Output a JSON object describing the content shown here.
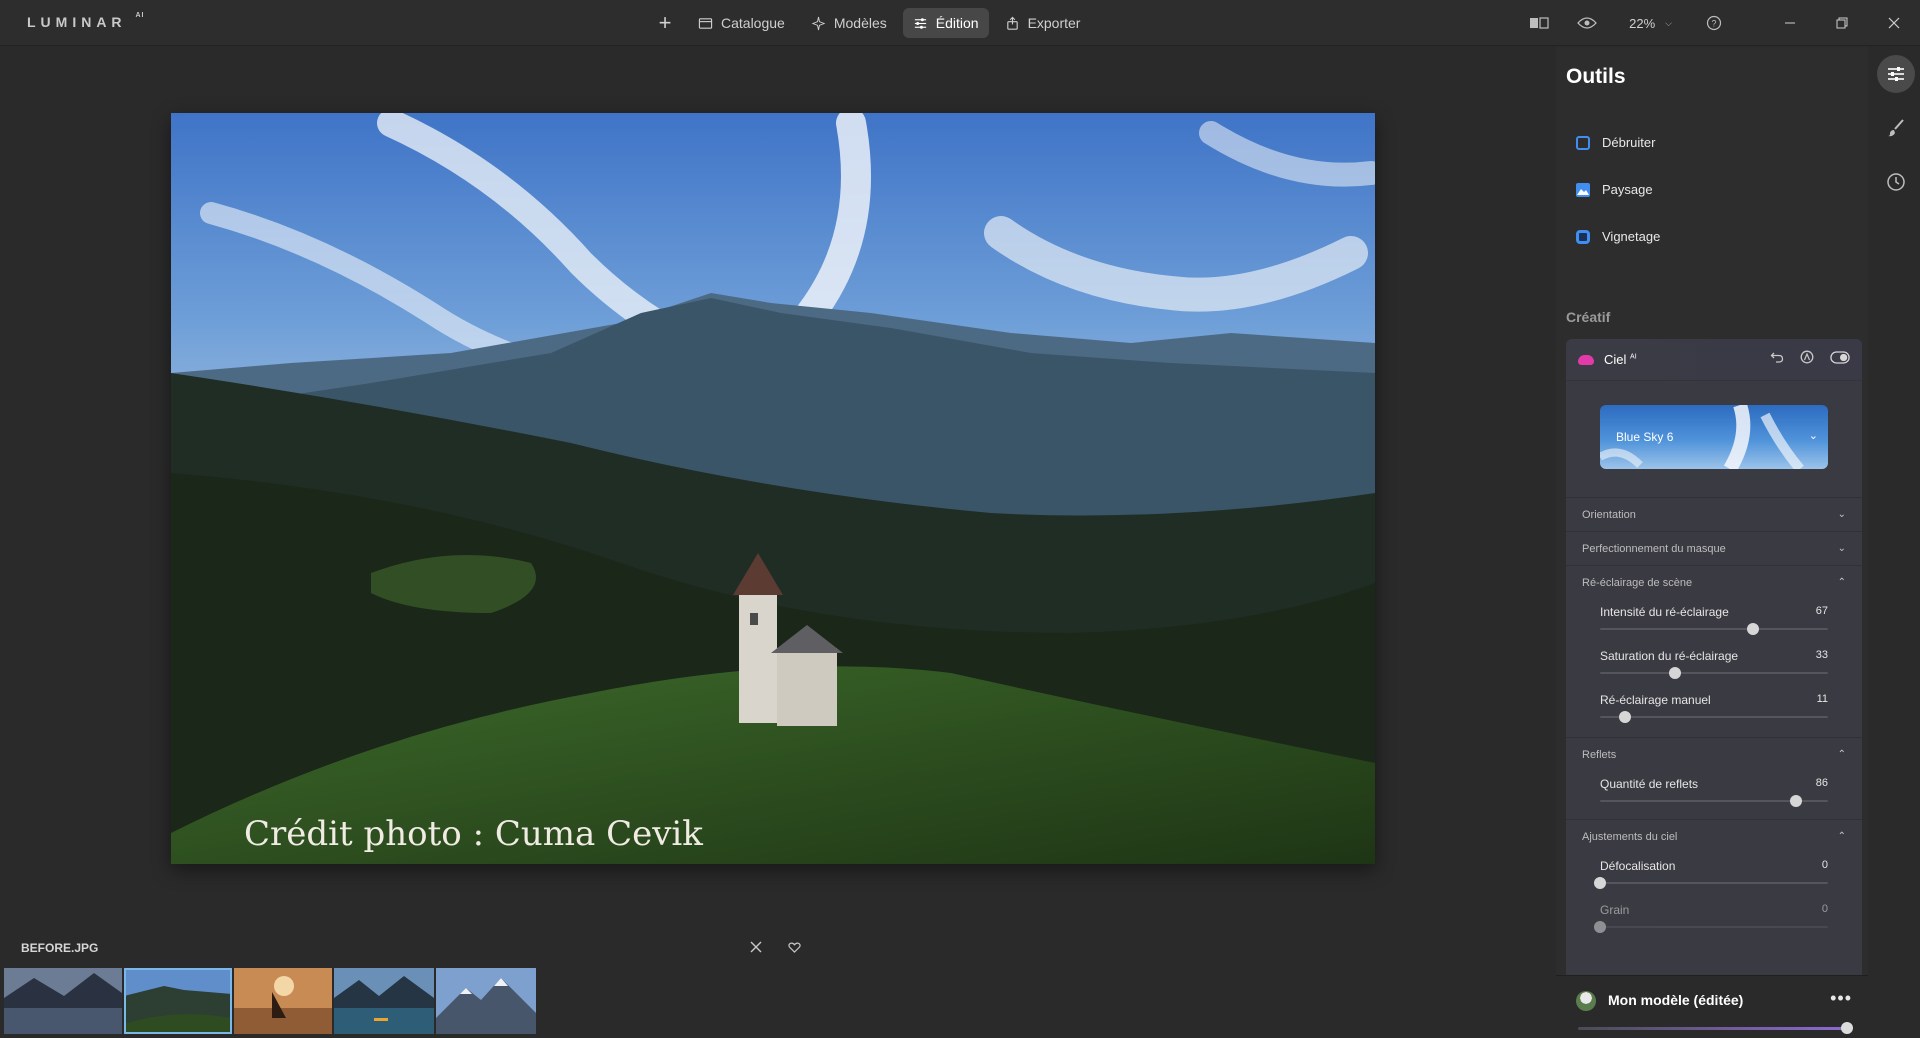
{
  "app": {
    "logo": "LUMINAR",
    "logo_sup": "AI"
  },
  "nav": {
    "add_label": "+",
    "tabs": [
      {
        "label": "Catalogue",
        "icon": "folder-icon"
      },
      {
        "label": "Modèles",
        "icon": "sparkle-icon"
      },
      {
        "label": "Édition",
        "icon": "sliders-icon",
        "active": true
      },
      {
        "label": "Exporter",
        "icon": "export-icon"
      }
    ]
  },
  "toolbar": {
    "zoom": "22%"
  },
  "photo": {
    "credit": "Crédit photo : Cuma Cevik"
  },
  "filmstrip": {
    "filename": "BEFORE.JPG",
    "thumbnails": [
      "lake-reflection",
      "church-hill",
      "sailboat-sunset",
      "kayak-lake",
      "snowy-mountains"
    ],
    "selected_index": 1
  },
  "panel": {
    "title": "Outils",
    "tools": [
      {
        "label": "Débruiter",
        "icon": "checkbox-icon"
      },
      {
        "label": "Paysage",
        "icon": "landscape-icon"
      },
      {
        "label": "Vignetage",
        "icon": "vignette-icon"
      }
    ],
    "section": "Créatif",
    "sky": {
      "title": "Ciel",
      "title_sup": "AI",
      "selected_sky": "Blue Sky 6",
      "collapsed_rows": [
        "Orientation",
        "Perfectionnement du masque"
      ],
      "relight": {
        "label": "Ré-éclairage de scène",
        "sliders": [
          {
            "label": "Intensité du ré-éclairage",
            "value": "67",
            "fraction": 0.67
          },
          {
            "label": "Saturation du ré-éclairage",
            "value": "33",
            "fraction": 0.33
          },
          {
            "label": "Ré-éclairage manuel",
            "value": "11",
            "fraction": 0.11
          }
        ]
      },
      "reflections": {
        "label": "Reflets",
        "sliders": [
          {
            "label": "Quantité de reflets",
            "value": "86",
            "fraction": 0.86
          }
        ]
      },
      "adjustments": {
        "label": "Ajustements du ciel",
        "sliders": [
          {
            "label": "Défocalisation",
            "value": "0",
            "fraction": 0.0
          },
          {
            "label": "Grain",
            "value": "0",
            "fraction": 0.0
          }
        ]
      }
    },
    "model": {
      "name": "Mon modèle (éditée)",
      "more": "•••",
      "fraction": 0.98
    }
  },
  "colors": {
    "accent": "#3f8ef0",
    "sky_icon": "#e23ba9",
    "selected_outline": "#7ab8e8"
  }
}
